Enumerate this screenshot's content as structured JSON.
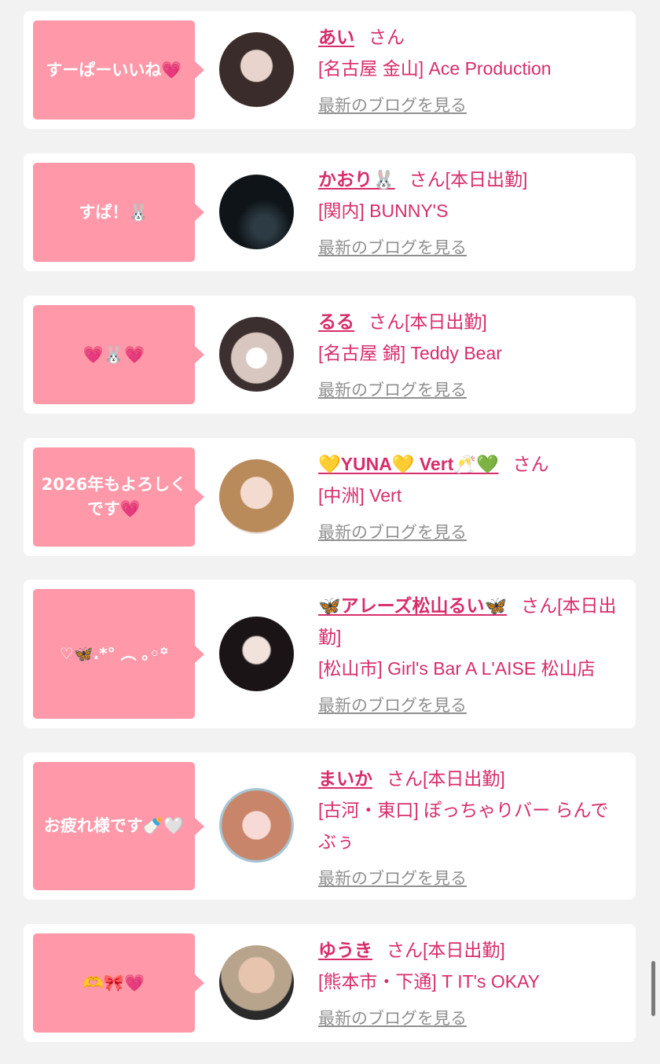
{
  "entries": [
    {
      "bubble": "すーぱーいいね💗",
      "name": "あい",
      "suffix": "さん",
      "shop": "[名古屋 金山] Ace Production",
      "blog": "最新のブログを見る"
    },
    {
      "bubble": "すぱ！🐰",
      "name": "かおり🐰",
      "suffix": "さん[本日出勤]",
      "shop": "[関内] BUNNY'S",
      "blog": "最新のブログを見る"
    },
    {
      "bubble": "💗🐰💗",
      "name": "るる",
      "suffix": "さん[本日出勤]",
      "shop": "[名古屋 錦] Teddy Bear",
      "blog": "最新のブログを見る"
    },
    {
      "bubble": "2026年もよろしくです💗",
      "name": "💛YUNA💛 Vert🥂💚",
      "suffix": "さん",
      "shop": "[中洲] Vert",
      "blog": "最新のブログを見る"
    },
    {
      "bubble": "♡🦋.*° ︵ ｡◦꙳",
      "name": "🦋アレーズ松山るい🦋",
      "suffix": "さん[本日出勤]",
      "shop": "[松山市] Girl's Bar A L'AISE 松山店",
      "blog": "最新のブログを見る"
    },
    {
      "bubble": "お疲れ様です🍼🤍",
      "name": "まいか",
      "suffix": "さん[本日出勤]",
      "shop": "[古河・東口] ぽっちゃりバー らんでぶぅ",
      "blog": "最新のブログを見る"
    },
    {
      "bubble": "🫶🎀💗",
      "name": "ゆうき",
      "suffix": "さん[本日出勤]",
      "shop": "[熊本市・下通] T IT's OKAY",
      "blog": "最新のブログを見る"
    }
  ],
  "colors": {
    "accent": "#d72d6a",
    "bubble": "#ff98a8",
    "blog_link": "#8f8f8f"
  }
}
